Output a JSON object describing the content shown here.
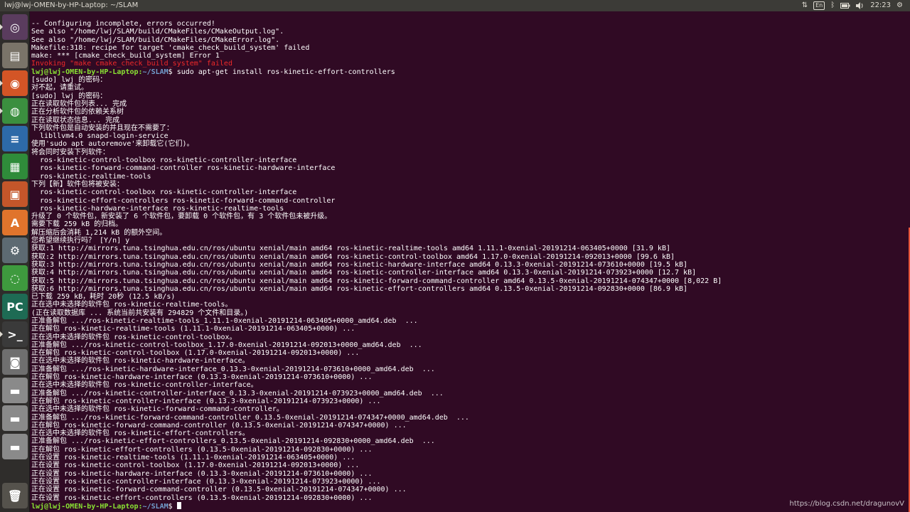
{
  "window": {
    "title": "lwj@lwj-OMEN-by-HP-Laptop: ~/SLAM"
  },
  "indicators": {
    "keyboard": "En",
    "clock": "22:23",
    "network_icon": "network-arrows-icon",
    "bluetooth_icon": "bluetooth-icon",
    "battery_icon": "battery-icon",
    "volume_icon": "volume-icon",
    "settings_icon": "gear-icon"
  },
  "launcher": [
    {
      "name": "ubuntu-dash-icon",
      "glyph": "◎",
      "bg": "#5a3c5e"
    },
    {
      "name": "files-icon",
      "glyph": "▤",
      "bg": "#7a7469"
    },
    {
      "name": "firefox-icon",
      "glyph": "◉",
      "bg": "#d35526"
    },
    {
      "name": "chrome-icon",
      "glyph": "◍",
      "bg": "#3b8f3f"
    },
    {
      "name": "writer-icon",
      "glyph": "≡",
      "bg": "#2d6aa8"
    },
    {
      "name": "calc-icon",
      "glyph": "▦",
      "bg": "#2f8c3a"
    },
    {
      "name": "impress-icon",
      "glyph": "▣",
      "bg": "#c4562a"
    },
    {
      "name": "software-center-icon",
      "glyph": "A",
      "bg": "#e0742c"
    },
    {
      "name": "system-settings-icon",
      "glyph": "⚙",
      "bg": "#5d6a72"
    },
    {
      "name": "update-icon",
      "glyph": "◌",
      "bg": "#3e9a3e"
    },
    {
      "name": "pycharm-icon",
      "glyph": "PC",
      "bg": "#1e6b54"
    },
    {
      "name": "terminal-icon",
      "glyph": ">_",
      "bg": "#3a3a3a"
    },
    {
      "name": "camera-icon",
      "glyph": "◙",
      "bg": "#6f6f6f"
    },
    {
      "name": "drive-1-icon",
      "glyph": "▬",
      "bg": "#8a8a8a"
    },
    {
      "name": "drive-2-icon",
      "glyph": "▬",
      "bg": "#8a8a8a"
    },
    {
      "name": "drive-3-icon",
      "glyph": "▬",
      "bg": "#8a8a8a"
    },
    {
      "name": "trash-icon",
      "glyph": "🗑",
      "bg": "#55524c"
    }
  ],
  "terminal": {
    "prompt_user": "lwj@lwj-OMEN-by-HP-Laptop",
    "prompt_path": "~/SLAM",
    "lines": [
      {
        "t": "-- Configuring incomplete, errors occurred!"
      },
      {
        "t": "See also \"/home/lwj/SLAM/build/CMakeFiles/CMakeOutput.log\"."
      },
      {
        "t": "See also \"/home/lwj/SLAM/build/CMakeFiles/CMakeError.log\"."
      },
      {
        "t": "Makefile:318: recipe for target 'cmake_check_build_system' failed"
      },
      {
        "t": "make: *** [cmake_check_build_system] Error 1"
      },
      {
        "t": "Invoking \"make cmake_check_build_system\" failed",
        "c": "red"
      },
      {
        "prompt": true,
        "cmd": "sudo apt-get install ros-kinetic-effort-controllers"
      },
      {
        "t": "[sudo] lwj 的密码："
      },
      {
        "t": "对不起，请重试。"
      },
      {
        "t": "[sudo] lwj 的密码："
      },
      {
        "t": "正在读取软件包列表... 完成"
      },
      {
        "t": "正在分析软件包的依赖关系树"
      },
      {
        "t": "正在读取状态信息... 完成"
      },
      {
        "t": "下列软件包是自动安装的并且现在不需要了："
      },
      {
        "t": "  libllvm4.0 snapd-login-service"
      },
      {
        "t": "使用'sudo apt autoremove'来卸载它(它们)。"
      },
      {
        "t": "将会同时安装下列软件："
      },
      {
        "t": "  ros-kinetic-control-toolbox ros-kinetic-controller-interface"
      },
      {
        "t": "  ros-kinetic-forward-command-controller ros-kinetic-hardware-interface"
      },
      {
        "t": "  ros-kinetic-realtime-tools"
      },
      {
        "t": "下列【新】软件包将被安装："
      },
      {
        "t": "  ros-kinetic-control-toolbox ros-kinetic-controller-interface"
      },
      {
        "t": "  ros-kinetic-effort-controllers ros-kinetic-forward-command-controller"
      },
      {
        "t": "  ros-kinetic-hardware-interface ros-kinetic-realtime-tools"
      },
      {
        "t": "升级了 0 个软件包，新安装了 6 个软件包，要卸载 0 个软件包，有 3 个软件包未被升级。"
      },
      {
        "t": "需要下载 259 kB 的归档。"
      },
      {
        "t": "解压缩后会消耗 1,214 kB 的额外空间。"
      },
      {
        "t": "您希望继续执行吗？ [Y/n] y"
      },
      {
        "t": "获取:1 http://mirrors.tuna.tsinghua.edu.cn/ros/ubuntu xenial/main amd64 ros-kinetic-realtime-tools amd64 1.11.1-0xenial-20191214-063405+0000 [31.9 kB]"
      },
      {
        "t": "获取:2 http://mirrors.tuna.tsinghua.edu.cn/ros/ubuntu xenial/main amd64 ros-kinetic-control-toolbox amd64 1.17.0-0xenial-20191214-092013+0000 [99.6 kB]"
      },
      {
        "t": "获取:3 http://mirrors.tuna.tsinghua.edu.cn/ros/ubuntu xenial/main amd64 ros-kinetic-hardware-interface amd64 0.13.3-0xenial-20191214-073610+0000 [19.5 kB]"
      },
      {
        "t": "获取:4 http://mirrors.tuna.tsinghua.edu.cn/ros/ubuntu xenial/main amd64 ros-kinetic-controller-interface amd64 0.13.3-0xenial-20191214-073923+0000 [12.7 kB]"
      },
      {
        "t": "获取:5 http://mirrors.tuna.tsinghua.edu.cn/ros/ubuntu xenial/main amd64 ros-kinetic-forward-command-controller amd64 0.13.5-0xenial-20191214-074347+0000 [8,022 B]"
      },
      {
        "t": "获取:6 http://mirrors.tuna.tsinghua.edu.cn/ros/ubuntu xenial/main amd64 ros-kinetic-effort-controllers amd64 0.13.5-0xenial-20191214-092830+0000 [86.9 kB]"
      },
      {
        "t": "已下载 259 kB，耗时 20秒 (12.5 kB/s)"
      },
      {
        "t": "正在选中未选择的软件包 ros-kinetic-realtime-tools。"
      },
      {
        "t": "(正在读取数据库 ... 系统当前共安装有 294829 个文件和目录。)"
      },
      {
        "t": "正准备解包 .../ros-kinetic-realtime-tools_1.11.1-0xenial-20191214-063405+0000_amd64.deb  ..."
      },
      {
        "t": "正在解包 ros-kinetic-realtime-tools (1.11.1-0xenial-20191214-063405+0000) ..."
      },
      {
        "t": "正在选中未选择的软件包 ros-kinetic-control-toolbox。"
      },
      {
        "t": "正准备解包 .../ros-kinetic-control-toolbox_1.17.0-0xenial-20191214-092013+0000_amd64.deb  ..."
      },
      {
        "t": "正在解包 ros-kinetic-control-toolbox (1.17.0-0xenial-20191214-092013+0000) ..."
      },
      {
        "t": "正在选中未选择的软件包 ros-kinetic-hardware-interface。"
      },
      {
        "t": "正准备解包 .../ros-kinetic-hardware-interface_0.13.3-0xenial-20191214-073610+0000_amd64.deb  ..."
      },
      {
        "t": "正在解包 ros-kinetic-hardware-interface (0.13.3-0xenial-20191214-073610+0000) ..."
      },
      {
        "t": "正在选中未选择的软件包 ros-kinetic-controller-interface。"
      },
      {
        "t": "正准备解包 .../ros-kinetic-controller-interface_0.13.3-0xenial-20191214-073923+0000_amd64.deb  ..."
      },
      {
        "t": "正在解包 ros-kinetic-controller-interface (0.13.3-0xenial-20191214-073923+0000) ..."
      },
      {
        "t": "正在选中未选择的软件包 ros-kinetic-forward-command-controller。"
      },
      {
        "t": "正准备解包 .../ros-kinetic-forward-command-controller_0.13.5-0xenial-20191214-074347+0000_amd64.deb  ..."
      },
      {
        "t": "正在解包 ros-kinetic-forward-command-controller (0.13.5-0xenial-20191214-074347+0000) ..."
      },
      {
        "t": "正在选中未选择的软件包 ros-kinetic-effort-controllers。"
      },
      {
        "t": "正准备解包 .../ros-kinetic-effort-controllers_0.13.5-0xenial-20191214-092830+0000_amd64.deb  ..."
      },
      {
        "t": "正在解包 ros-kinetic-effort-controllers (0.13.5-0xenial-20191214-092830+0000) ..."
      },
      {
        "t": "正在设置 ros-kinetic-realtime-tools (1.11.1-0xenial-20191214-063405+0000) ..."
      },
      {
        "t": "正在设置 ros-kinetic-control-toolbox (1.17.0-0xenial-20191214-092013+0000) ..."
      },
      {
        "t": "正在设置 ros-kinetic-hardware-interface (0.13.3-0xenial-20191214-073610+0000) ..."
      },
      {
        "t": "正在设置 ros-kinetic-controller-interface (0.13.3-0xenial-20191214-073923+0000) ..."
      },
      {
        "t": "正在设置 ros-kinetic-forward-command-controller (0.13.5-0xenial-20191214-074347+0000) ..."
      },
      {
        "t": "正在设置 ros-kinetic-effort-controllers (0.13.5-0xenial-20191214-092830+0000) ..."
      },
      {
        "prompt": true,
        "cmd": "",
        "cursor": true
      }
    ]
  },
  "watermark": "https://blog.csdn.net/dragunovV"
}
